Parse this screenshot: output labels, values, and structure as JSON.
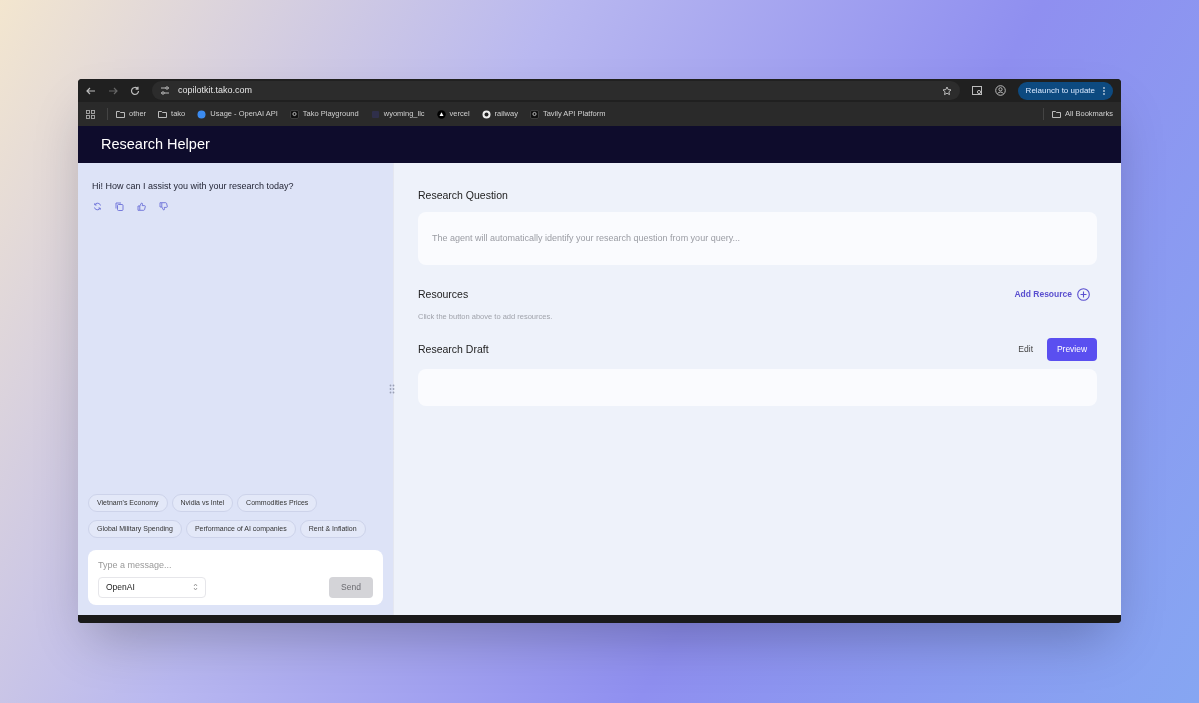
{
  "browser": {
    "address": "copilotkit.tako.com",
    "relaunch_button": "Relaunch to update",
    "bookmarks": [
      {
        "label": "other",
        "kind": "folder"
      },
      {
        "label": "tako",
        "kind": "folder"
      },
      {
        "label": "Usage - OpenAI API",
        "kind": "circle"
      },
      {
        "label": "Tako Playground",
        "kind": "badge"
      },
      {
        "label": "wyoming_llc",
        "kind": "square"
      },
      {
        "label": "vercel",
        "kind": "triangle"
      },
      {
        "label": "railway",
        "kind": "ring"
      },
      {
        "label": "Tavily API Platform",
        "kind": "badge"
      }
    ],
    "all_bookmarks": "All Bookmarks"
  },
  "app": {
    "title": "Research Helper",
    "chat": {
      "messages": [
        {
          "text": "Hi! How can I assist you with your research today?"
        }
      ],
      "suggestions": [
        "Vietnam's Economy",
        "Nvidia vs Intel",
        "Commodities Prices",
        "Global Military Spending",
        "Performance of AI companies",
        "Rent & Inflation"
      ],
      "input": {
        "placeholder": "Type a message..."
      },
      "model_select": {
        "value": "OpenAI"
      },
      "send_button": {
        "label": "Send",
        "disabled": true
      }
    },
    "research_question": {
      "title": "Research Question",
      "placeholder": "The agent will automatically identify your research question from your query..."
    },
    "resources": {
      "title": "Resources",
      "add_button": "Add Resource",
      "hint": "Click the button above to add resources."
    },
    "research_draft": {
      "title": "Research Draft",
      "edit_button": "Edit",
      "preview_button": "Preview"
    }
  }
}
